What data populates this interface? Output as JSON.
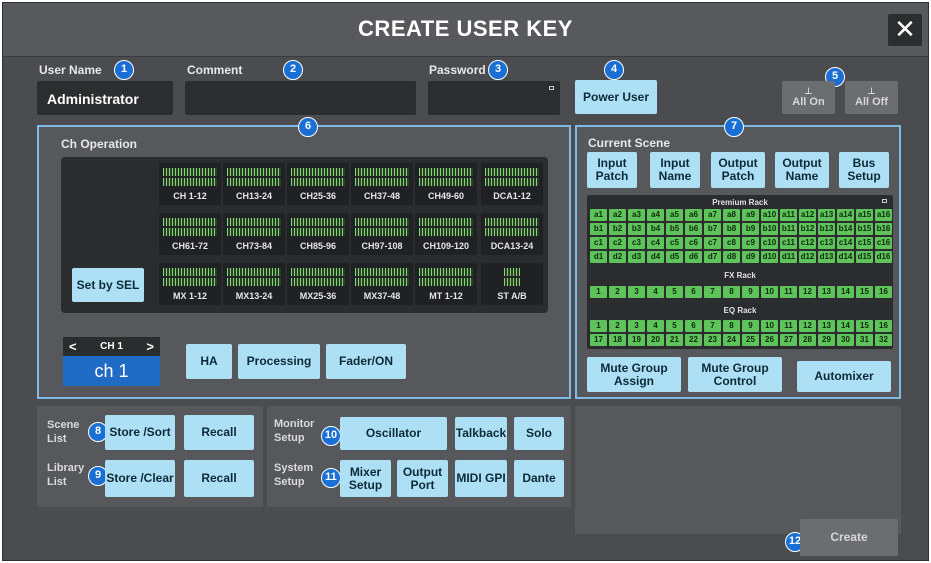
{
  "window": {
    "title": "CREATE USER KEY",
    "close_label": "✕"
  },
  "user_name": {
    "label": "User Name",
    "value": "Administrator"
  },
  "comment": {
    "label": "Comment",
    "value": ""
  },
  "password": {
    "label": "Password",
    "value": ""
  },
  "power_user": {
    "label": "Power User"
  },
  "all_on": {
    "label": "All On"
  },
  "all_off": {
    "label": "All Off"
  },
  "badges": [
    "1",
    "2",
    "3",
    "4",
    "5",
    "6",
    "7",
    "8",
    "9",
    "10",
    "11",
    "12"
  ],
  "ch_operation": {
    "title": "Ch Operation",
    "set_by_sel": "Set by SEL",
    "groups": [
      [
        "CH 1-12",
        "CH13-24",
        "CH25-36",
        "CH37-48",
        "CH49-60",
        "DCA1-12"
      ],
      [
        "CH61-72",
        "CH73-84",
        "CH85-96",
        "CH97-108",
        "CH109-120",
        "DCA13-24"
      ],
      [
        "MX 1-12",
        "MX13-24",
        "MX25-36",
        "MX37-48",
        "MT 1-12",
        "ST A/B"
      ]
    ],
    "channel_selector": {
      "prev": "<",
      "next": ">",
      "small": "CH 1",
      "name": "ch 1"
    },
    "buttons": [
      "HA",
      "Processing",
      "Fader/ON"
    ]
  },
  "current_scene": {
    "title": "Current Scene",
    "buttons": [
      "Input Patch",
      "Input Name",
      "Output Patch",
      "Output Name",
      "Bus Setup"
    ],
    "premium_rack": {
      "title": "Premium Rack",
      "rows": [
        [
          "a1",
          "a2",
          "a3",
          "a4",
          "a5",
          "a6",
          "a7",
          "a8",
          "a9",
          "a10",
          "a11",
          "a12",
          "a13",
          "a14",
          "a15",
          "a16"
        ],
        [
          "b1",
          "b2",
          "b3",
          "b4",
          "b5",
          "b6",
          "b7",
          "b8",
          "b9",
          "b10",
          "b11",
          "b12",
          "b13",
          "b14",
          "b15",
          "b16"
        ],
        [
          "c1",
          "c2",
          "c3",
          "c4",
          "c5",
          "c6",
          "c7",
          "c8",
          "c9",
          "c10",
          "c11",
          "c12",
          "c13",
          "c14",
          "c15",
          "c16"
        ],
        [
          "d1",
          "d2",
          "d3",
          "d4",
          "d5",
          "d6",
          "d7",
          "d8",
          "d9",
          "d10",
          "d11",
          "d12",
          "d13",
          "d14",
          "d15",
          "d16"
        ]
      ]
    },
    "fx_rack": {
      "title": "FX Rack",
      "items": [
        "1",
        "2",
        "3",
        "4",
        "5",
        "6",
        "7",
        "8",
        "9",
        "10",
        "11",
        "12",
        "13",
        "14",
        "15",
        "16"
      ]
    },
    "eq_rack": {
      "title": "EQ Rack",
      "rows": [
        [
          "1",
          "2",
          "3",
          "4",
          "5",
          "6",
          "7",
          "8",
          "9",
          "10",
          "11",
          "12",
          "13",
          "14",
          "15",
          "16"
        ],
        [
          "17",
          "18",
          "19",
          "20",
          "21",
          "22",
          "23",
          "24",
          "25",
          "26",
          "27",
          "28",
          "29",
          "30",
          "31",
          "32"
        ]
      ]
    },
    "mute_group_assign": "Mute Group Assign",
    "mute_group_control": "Mute Group Control",
    "automixer": "Automixer"
  },
  "scene_list": {
    "label": "Scene List",
    "store": "Store /Sort",
    "recall": "Recall"
  },
  "library_list": {
    "label": "Library List",
    "store": "Store /Clear",
    "recall": "Recall"
  },
  "monitor_setup": {
    "label": "Monitor Setup",
    "oscillator": "Oscillator",
    "talkback": "Talkback",
    "solo": "Solo"
  },
  "system_setup": {
    "label": "System Setup",
    "mixer_setup": "Mixer Setup",
    "output_port": "Output Port",
    "midi_gpi": "MIDI GPI",
    "dante": "Dante"
  },
  "create": {
    "label": "Create"
  },
  "colors": {
    "accent": "#aee0f5",
    "badge": "#1a6fd4",
    "rack_green": "#5ec35a",
    "selection": "#7fb9e6"
  }
}
